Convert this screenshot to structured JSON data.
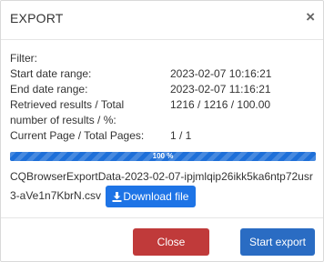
{
  "dialog": {
    "title": "EXPORT",
    "close_symbol": "×"
  },
  "info": {
    "filter_label": "Filter:",
    "rows": [
      {
        "label": "Start date range:",
        "value": "2023-02-07 10:16:21"
      },
      {
        "label": "End date range:",
        "value": "2023-02-07 11:16:21"
      },
      {
        "label": "Retrieved results / Total",
        "value": "1216 / 1216 / 100.00"
      },
      {
        "label": "number of results / %:",
        "value": ""
      },
      {
        "label": "Current Page / Total Pages:",
        "value": "1 / 1"
      }
    ]
  },
  "progress": {
    "percent": 100,
    "label": "100 %"
  },
  "download": {
    "filename": "CQBrowserExportData-2023-02-07-ipjmlqip26ikk5ka6ntp72usr3-aVe1n7KbrN.csv",
    "button_label": "Download file",
    "icon": "download-icon"
  },
  "footer": {
    "close_label": "Close",
    "start_label": "Start export"
  },
  "colors": {
    "close_button": "#c03a3a",
    "start_button": "#2a6cc3",
    "progress_bar": "#1e6fd8",
    "download_button": "#1e74e6"
  }
}
